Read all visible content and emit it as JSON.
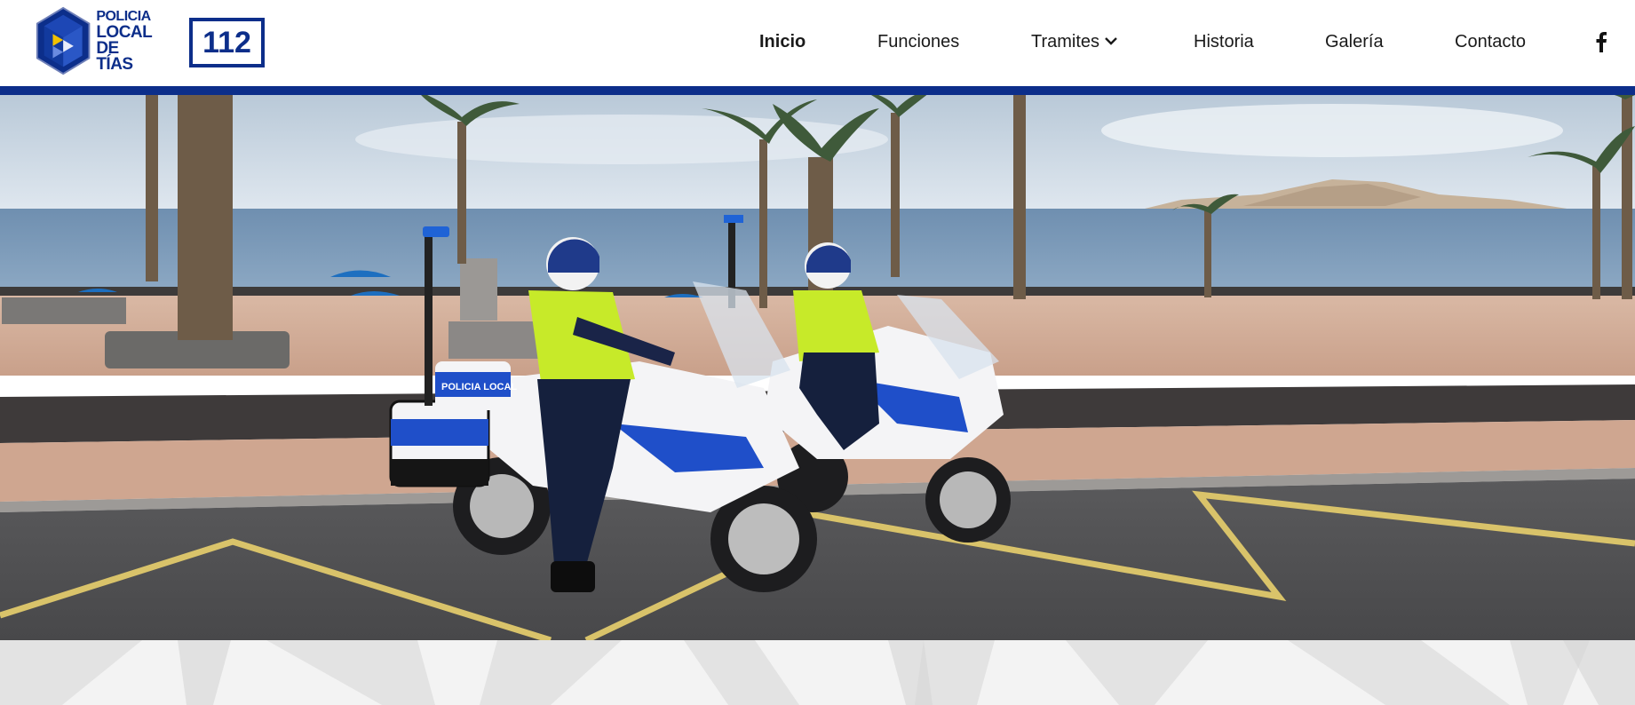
{
  "brand": {
    "logo_line1": "POLICIA",
    "logo_line2": "LOCAL",
    "logo_line3": "DE TÍAS",
    "emergency_number": "112",
    "primary_color": "#0c2e8a",
    "accent_color": "#f2c200"
  },
  "nav": {
    "items": [
      {
        "label": "Inicio",
        "active": true
      },
      {
        "label": "Funciones",
        "active": false
      },
      {
        "label": "Tramites",
        "active": false,
        "has_dropdown": true
      },
      {
        "label": "Historia",
        "active": false
      },
      {
        "label": "Galería",
        "active": false
      },
      {
        "label": "Contacto",
        "active": false
      }
    ],
    "social_icon": "facebook-icon"
  },
  "hero": {
    "image": "police-motorcycles-seafront-photo",
    "motorcycle_label": "POLICIA LOCAL"
  }
}
